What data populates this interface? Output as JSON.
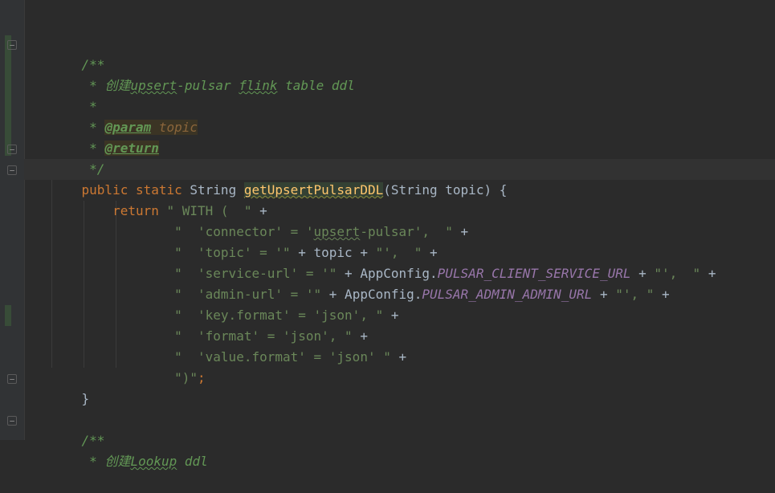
{
  "editor": {
    "language": "Java",
    "theme_colors": {
      "background": "#2b2b2b",
      "keyword": "#cc7832",
      "string": "#6a8759",
      "doc_comment": "#629755",
      "method": "#ffc66d",
      "constant": "#9876aa",
      "text": "#a9b7c6"
    },
    "lines": {
      "l1": {
        "open": "/**"
      },
      "l2": {
        "star": " * ",
        "cn": "创建",
        "w1": "upsert",
        "w2": "-pulsar ",
        "w3": "flink",
        "w4": " table ddl"
      },
      "l3": {
        "text": " *"
      },
      "l4": {
        "star": " * ",
        "tag": "@param",
        "sp": " ",
        "param": "topic"
      },
      "l5": {
        "star": " * ",
        "tag": "@return"
      },
      "l6": {
        "text": " */"
      },
      "l7": {
        "kw1": "public",
        "sp1": " ",
        "kw2": "static",
        "sp2": " String ",
        "fn": "getUpsertPulsarDDL",
        "rest": "(String topic) {"
      },
      "l8": {
        "indent": "    ",
        "kw": "return",
        "sp": " ",
        "s1": "\" WITH (  \"",
        "rest": " +"
      },
      "l9": {
        "indent": "            ",
        "s1": "\"  'connector' = '",
        "s2": "upsert",
        "s3": "-pulsar',  \"",
        "rest": " +"
      },
      "l10": {
        "indent": "            ",
        "s1": "\"  'topic' = '\"",
        "p1": " + topic + ",
        "s2": "\"',  \"",
        "rest": " +"
      },
      "l11": {
        "indent": "            ",
        "s1": "\"  'service-url' = '\"",
        "p1": " + AppConfig.",
        "c1": "PULSAR_CLIENT_SERVICE_URL",
        "p2": " + ",
        "s2": "\"',  \"",
        "rest": " +"
      },
      "l12": {
        "indent": "            ",
        "s1": "\"  'admin-url' = '\"",
        "p1": " + AppConfig.",
        "c1": "PULSAR_ADMIN_ADMIN_URL",
        "p2": " + ",
        "s2": "\"', \"",
        "rest": " +"
      },
      "l13": {
        "indent": "            ",
        "s1": "\"  'key.format' = 'json', \"",
        "rest": " +"
      },
      "l14": {
        "indent": "            ",
        "s1": "\"  'format' = 'json', \"",
        "rest": " +"
      },
      "l15": {
        "indent": "            ",
        "s1": "\"  'value.format' = 'json' \"",
        "rest": " +"
      },
      "l16": {
        "indent": "            ",
        "s1": "\")\"",
        "semi": ";"
      },
      "l17": {
        "text": "}"
      },
      "l18": {
        "text": ""
      },
      "l19": {
        "open": "/**"
      },
      "l20": {
        "star": " * ",
        "cn": "创建",
        "w1": "Lookup",
        "w2": " ddl"
      }
    }
  }
}
